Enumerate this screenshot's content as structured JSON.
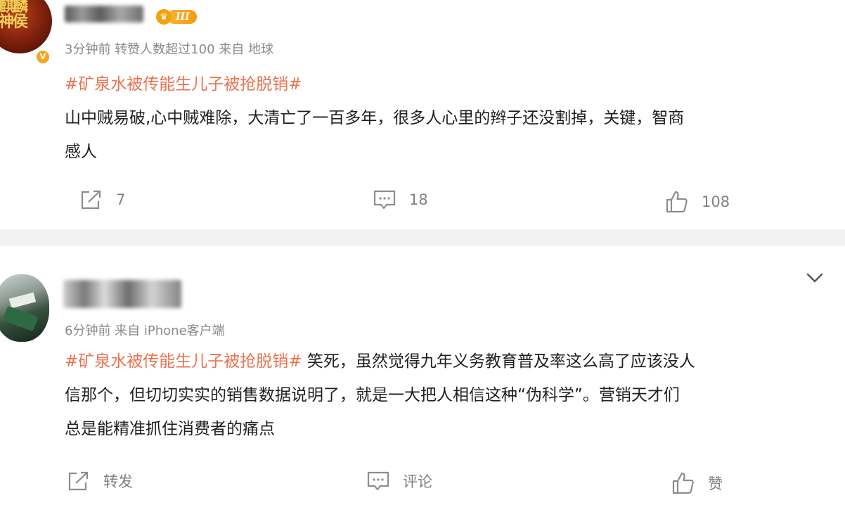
{
  "post1": {
    "avatar_text": "麒麟神侯",
    "verified_badge": "V",
    "level_badge": "III",
    "meta": "3分钟前  转赞人数超过100   来自 地球",
    "hashtag": "#矿泉水被传能生儿子被抢脱销#",
    "content_lines": [
      "山中贼易破,心中贼难除，大清亡了一百多年，很多人心里的辫子还没割掉，关键，智商",
      "感人"
    ],
    "actions": {
      "repost": "7",
      "comment": "18",
      "like": "108"
    }
  },
  "post2": {
    "meta": "6分钟前  来自 iPhone客户端",
    "hashtag": "#矿泉水被传能生儿子被抢脱销#",
    "content_first_tail": " 笑死，虽然觉得九年义务教育普及率这么高了应该没人",
    "content_lines": [
      "信那个，但切切实实的销售数据说明了，就是一大把人相信这种“伪科学”。营销天才们",
      "总是能精准抓住消费者的痛点"
    ],
    "actions": {
      "repost": "转发",
      "comment": "评论",
      "like": "赞"
    }
  },
  "colors": {
    "hashtag": "#eb7350",
    "meta": "#8a8a8a",
    "level": "#f39a12"
  },
  "icons": [
    "share-icon",
    "comment-icon",
    "thumbs-up-icon",
    "chevron-down-icon",
    "crown-icon"
  ]
}
